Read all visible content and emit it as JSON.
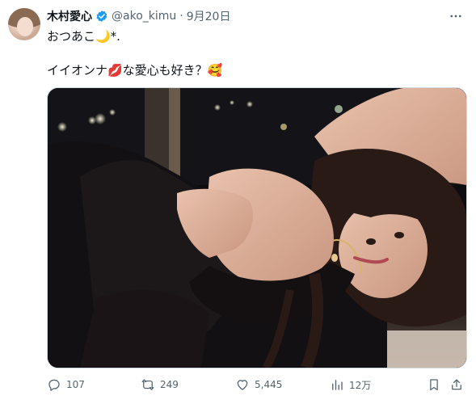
{
  "tweet": {
    "author_name": "木村愛心",
    "handle": "@ako_kimu",
    "separator": "·",
    "date": "9月20日",
    "line1": "おつあこ🌙*.",
    "line2": "イイオンナ💋な愛心も好き？🥰"
  },
  "icons": {
    "verified": "verified-badge-icon",
    "more": "more-icon",
    "reply": "reply-icon",
    "retweet": "retweet-icon",
    "like": "heart-icon",
    "views": "views-icon",
    "bookmark": "bookmark-icon",
    "share": "share-icon"
  },
  "actions": {
    "reply_count": "107",
    "retweet_count": "249",
    "like_count": "5,445",
    "view_count": "12万"
  },
  "colors": {
    "verified": "#1d9bf0",
    "text": "#0f1419",
    "muted": "#536471",
    "border": "#cfd9de"
  }
}
